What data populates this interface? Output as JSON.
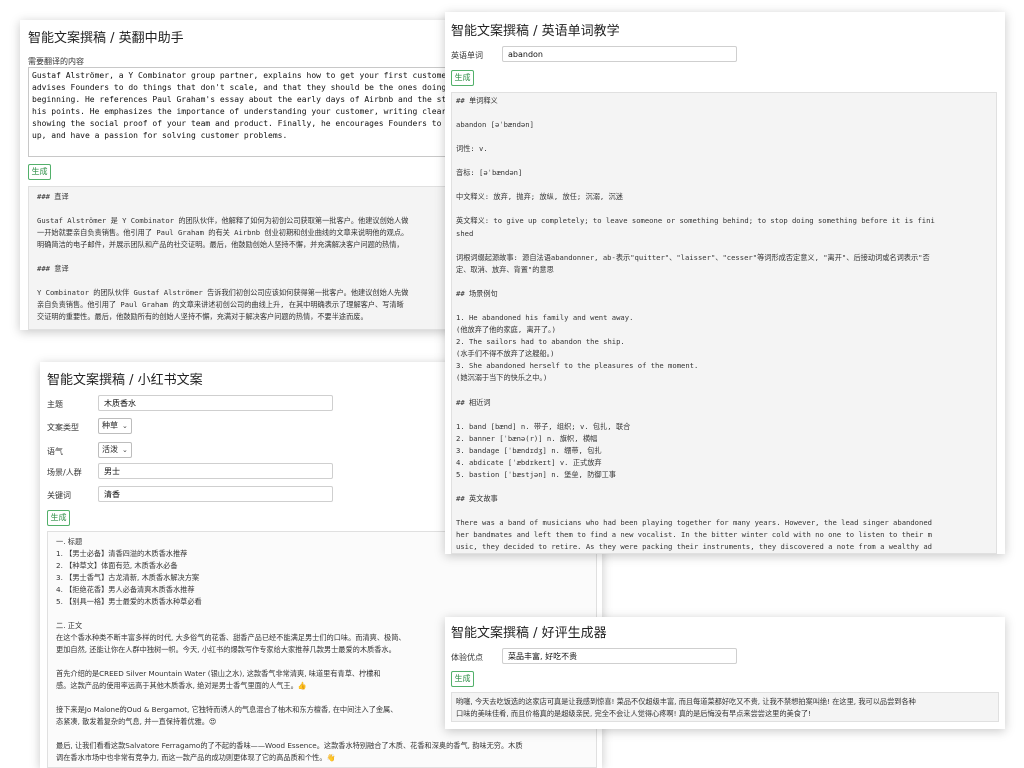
{
  "translator": {
    "title": "智能文案撰稿 / 英翻中助手",
    "input_label": "需要翻译的内容",
    "input_lines": [
      "Gustaf Alströmer, a Y Combinator group partner, explains how to get your first custome",
      "advises Founders to do things that don't scale, and that they should be the ones doing",
      "beginning. He references Paul Graham's essay about the early days of Airbnb and the st",
      "his points. He emphasizes the importance of understanding your customer, writing clear",
      "showing the social proof of your team and product. Finally, he encourages Founders to",
      "up, and have a passion for solving customer problems."
    ],
    "generate_label": "生成",
    "output_lines": [
      "### 直译",
      "",
      "Gustaf Alströmer 是 Y Combinator 的团队伙伴，他解释了如何为初创公司获取第一批客户。他建议创始人做",
      "一开始就要亲自负责销售。他引用了 Paul Graham 的有关 Airbnb 创业初期和创业曲线的文章来说明他的观点。",
      "明确简洁的电子邮件，并展示团队和产品的社交证明。最后，他鼓励创始人坚持不懈，并充满解决客户问题的热情，",
      "",
      "### 意译",
      "",
      "Y Combinator 的团队伙伴 Gustaf Alströmer 告诉我们初创公司应该如何获得第一批客户。他建议创始人先做",
      "亲自负责销售。他引用了 Paul Graham 的文章来讲述初创公司的曲线上升, 在其中明确表示了理解客户、写清晰",
      "交证明的重要性。最后，他鼓励所有的创始人坚持不懈，充满对于解决客户问题的热情，不要半途而废。"
    ]
  },
  "vocab": {
    "title": "智能文案撰稿 / 英语单词教学",
    "word_label": "英语单词",
    "word_value": "abandon",
    "generate_label": "生成",
    "output_lines": [
      "## 单词释义",
      "",
      "abandon [əˈbændən]",
      "",
      "词性: v.",
      "",
      "音标: [əˈbændən]",
      "",
      "中文释义: 放弃, 抛弃; 放纵, 放任; 沉溺, 沉迷",
      "",
      "英文释义: to give up completely; to leave someone or something behind; to stop doing something before it is fini",
      "shed",
      "",
      "词根词缀起源故事: 源自法语abandonner, ab-表示\"quitter\"、\"laisser\"、\"cesser\"等词形成否定意义, \"离开\"、后接动词或名词表示\"否",
      "定、取消、放弃、背置\"的意思",
      "",
      "## 场景例句",
      "",
      "1. He abandoned his family and went away.",
      "(他放弃了他的家庭, 离开了。)",
      "2. The sailors had to abandon the ship.",
      "(水手们不得不放弃了这艘船。)",
      "3. She abandoned herself to the pleasures of the moment.",
      "(她沉溺于当下的快乐之中。)",
      "",
      "## 相近词",
      "",
      "1. band [bænd] n. 带子, 组织; v. 包扎, 联合",
      "2. banner [ˈbænə(r)] n. 旗帜, 横幅",
      "3. bandage [ˈbændɪdʒ] n. 绷带, 包扎",
      "4. abdicate [ˈæbdɪkeɪt] v. 正式放弃",
      "5. bastion [ˈbæstjən] n. 堡垒, 防御工事",
      "",
      "## 英文故事",
      "",
      "There was a band of musicians who had been playing together for many years. However, the lead singer abandoned",
      "her bandmates and left them to find a new vocalist. In the bitter winter cold with no one to listen to their m",
      "usic, they decided to retire. As they were packing their instruments, they discovered a note from a wealthy ad"
    ]
  },
  "xhs": {
    "title": "智能文案撰稿 / 小红书文案",
    "fields": {
      "topic_label": "主题",
      "topic_value": "木质香水",
      "type_label": "文案类型",
      "type_value": "种草",
      "tone_label": "语气",
      "tone_value": "活泼",
      "audience_label": "场景/人群",
      "audience_value": "男士",
      "keyword_label": "关键词",
      "keyword_value": "清香"
    },
    "generate_label": "生成",
    "output_lines": [
      "一. 标题",
      "1. 【男士必备】清香四溢的木质香水推荐",
      "2. 【种草文】体面有范, 木质香水必备",
      "3. 【男士香气】古龙清新, 木质香水解决方案",
      "4. 【拒绝花香】男人必备清爽木质香水推荐",
      "5. 【别具一格】男士最爱的木质香水种草必看",
      "",
      "二. 正文",
      "在这个香水种类不断丰富多样的时代, 大多俗气的花香、甜香产品已经不能满足男士们的口味。而清爽、极简、",
      "更加自然, 还能让你在人群中独树一帜。今天, 小红书的爆款写作专家给大家推荐几款男士最爱的木质香水。",
      "",
      "首先介绍的是CREED Silver Mountain Water (银山之水), 这款香气非常清爽, 味道里有青草、柠檬和",
      "感。这款产品的使用率远高于其他木质香水, 绝对是男士香气里面的人气王。👍",
      "",
      "接下来是Jo Malone的Oud & Bergamot, 它独特而诱人的气息混合了柚木和东方檀香, 在中间注入了金属、",
      "态紧凑, 散发着复杂的气息, 并一直保持着优雅。😍",
      "",
      "最后, 让我们看看这款Salvatore Ferragamo的了不起的香味——Wood Essence。这款香水特别融合了木质、花香和深奥的香气, 韵味无穷。木质",
      "调在香水市场中也非常有竞争力, 而这一款产品的成功则更体现了它的高品质和个性。👋"
    ]
  },
  "review": {
    "title": "智能文案撰稿 / 好评生成器",
    "exp_label": "体验优点",
    "exp_value": "菜品丰富, 好吃不贵",
    "generate_label": "生成",
    "output_lines": [
      "哟噻, 今天去吃饭选的这家店可真是让我感到惊喜! 菜品不仅超级丰富, 而且每道菜都好吃又不贵, 让我不禁想拍案叫绝! 在这里, 我可以品尝到各种",
      "口味的美味佳肴, 而且价格真的是超级亲民, 完全不会让人觉得心疼啊! 真的是后悔没有早点来尝尝这里的美食了!"
    ]
  }
}
